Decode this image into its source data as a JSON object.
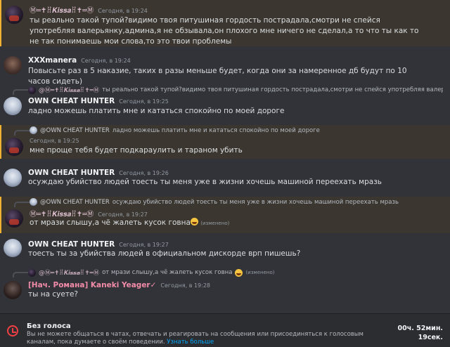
{
  "messages": [
    {
      "author": "Ⓜ═✝ꍬ𝑲𝒊𝒔𝒔𝒂ꍬ✝═Ⓜ",
      "time": "Сегодня, в 19:24",
      "text": "ты реально такой тупой?видимо твоя питушиная гордость пострадала,смотри не спейся употребляя валерьянку,админа,я не обзывала,он плохого мне ничего не сделал,а то что ты как то не так понимаешь мои слова,то это твои проблемы"
    },
    {
      "author": "XXXmanera",
      "time": "Сегодня, в 19:24",
      "text": "Повысьте раз в 5 наказие, таких в разы меньше будет, когда они за намеренное дб будут по 10 часов сидеть)"
    },
    {
      "reply_author": "@Ⓜ═✝ꍬ𝑲𝒊𝒔𝒔𝒂ꍬ✝═Ⓜ",
      "reply_text": "ты реально такой тупой?видимо твоя питушиная гордость пострадала,смотри не спейся употребляя валерья",
      "author": "OWN CHEAT HUNTER",
      "time": "Сегодня, в 19:25",
      "text": "ладно можешь платить мне и кататься спокойно по моей дороге"
    },
    {
      "reply_author": "@OWN CHEAT HUNTER",
      "reply_text": "ладно можешь платить мне и кататься спокойно по моей дороге",
      "time": "Сегодня, в 19:25",
      "text": "мне проще тебя будет подкараулить и тараном убить"
    },
    {
      "author": "OWN CHEAT HUNTER",
      "time": "Сегодня, в 19:26",
      "text": "осуждаю убийство людей тоесть ты меня уже в жизни хочешь машиной переехать мразь"
    },
    {
      "reply_author": "@OWN CHEAT HUNTER",
      "reply_text": "осуждаю убийство людей тоесть ты меня уже в жизни хочешь машиной переехать мразь",
      "author": "Ⓜ═✝ꍬ𝑲𝒊𝒔𝒔𝒂ꍬ✝═Ⓜ",
      "time": "Сегодня, в 19:27",
      "text": "от мрази слышу,а чё жалеть кусок говна",
      "edited": "(изменено)"
    },
    {
      "author": "OWN CHEAT HUNTER",
      "time": "Сегодня, в 19:27",
      "text": "тоесть ты за убийства людей в официальном дискорде врп пишешь?"
    },
    {
      "reply_author": "@Ⓜ═✝ꍬ𝑲𝒊𝒔𝒔𝒂ꍬ✝═Ⓜ",
      "reply_text": "от мрази слышу,а чё жалеть кусок говна",
      "reply_edited": "(изменено)",
      "author": "[Нач. Романа] Kaneki Yeager✓",
      "time": "Сегодня, в 19:28",
      "text": "ты на суете?"
    }
  ],
  "voice_bar": {
    "title": "Без голоса",
    "description": "Вы не можете общаться в чатах, отвечать и реагировать на сообщения или присоединяться к голосовым каналам, пока думаете о своём поведении.",
    "link": "Узнать больше",
    "timer_line1": "00ч. 52мин.",
    "timer_line2": "19сек."
  },
  "colors": {
    "background": "#313338",
    "mention_highlight": "#3b3730",
    "mention_border": "#f0b232",
    "danger": "#f23f43",
    "link": "#00a8fc"
  }
}
